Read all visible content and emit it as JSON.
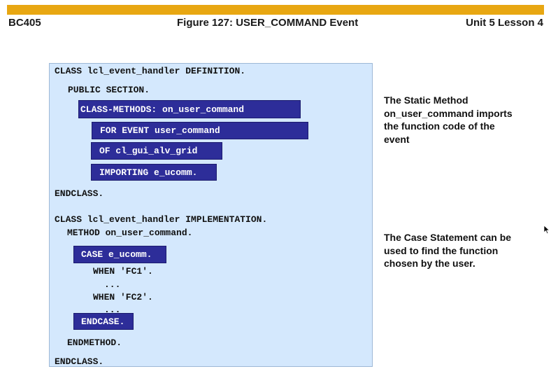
{
  "header": {
    "course": "BC405",
    "figure_title": "Figure 127: USER_COMMAND Event",
    "unit_lesson": "Unit 5 Lesson 4",
    "bar_color": "#e8a712"
  },
  "code": {
    "def_line": "CLASS lcl_event_handler DEFINITION.",
    "public_section": "PUBLIC SECTION.",
    "class_methods": "CLASS-METHODS: on_user_command",
    "for_event": "FOR EVENT user_command",
    "of_grid": "OF cl_gui_alv_grid",
    "importing": "IMPORTING e_ucomm.",
    "endclass_1": "ENDCLASS.",
    "impl_line": "CLASS lcl_event_handler IMPLEMENTATION.",
    "method_line": "METHOD on_user_command.",
    "case_line": "CASE e_ucomm.",
    "when_fc1": "WHEN 'FC1'.",
    "dots_1": "...",
    "when_fc2": "WHEN 'FC2'.",
    "dots_2": "...",
    "endcase": "ENDCASE.",
    "endmethod": "ENDMETHOD.",
    "endclass_2": "ENDCLASS.",
    "highlight_color": "#2d2d99",
    "panel_color": "#d4e8fd"
  },
  "notes": {
    "static_method": "The Static Method on_user_command imports the function code of the event",
    "case_statement": "The Case Statement can be used to find the function chosen by the user."
  },
  "icons": {
    "cursor": "mouse-pointer-icon"
  }
}
